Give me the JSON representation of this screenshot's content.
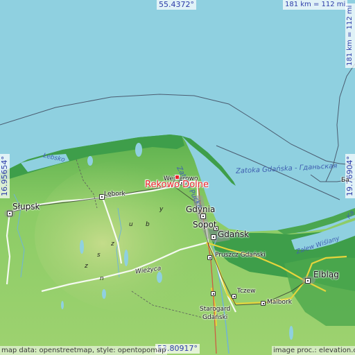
{
  "coordinates": {
    "lat_top": "55.4372°",
    "lat_bottom": "53.80917°",
    "lon_left": "16.95654°",
    "lon_right": "19.76904°"
  },
  "scale": {
    "top": "181 km = 112 mi",
    "right": "181 km = 112 mi"
  },
  "attribution": {
    "left": "map data: openstreetmap, style: opentopomap",
    "right": "image proc.: elevation.city"
  },
  "focus": {
    "name": "Rekowo Dolne",
    "color": "#e8232b"
  },
  "places": {
    "wejherowo": "Wejherowo",
    "lebork": "Lębork",
    "slupsk": "Słupsk",
    "gdynia": "Gdynia",
    "sopot": "Sopot",
    "gdansk": "Gdańsk",
    "pruszcz": "Pruszcz Gdański",
    "tczew": "Tczew",
    "starogard": "Starogard\nGdański",
    "malbork": "Malbork",
    "elblag": "Elbląg",
    "ba": "Ба",
    "wiezyca": "Wieżyca"
  },
  "water": {
    "zatoka_pucka": "Zatoka Pucka",
    "zatoka_gdanska": "Zatoka Gdańska - Гданьская",
    "zalew_wislany": "Zalew Wiślany",
    "lebsko": "Łebsko",
    "ka": "Ка"
  },
  "hill_letters": [
    "y",
    "b",
    "u",
    "z",
    "s",
    "z",
    "n"
  ],
  "colors": {
    "sea": "#8fd0e0",
    "low_green": "#3e9e4a",
    "mid_green": "#78c060",
    "high_green": "#b0d878",
    "label_blue": "#2b3ba8"
  }
}
